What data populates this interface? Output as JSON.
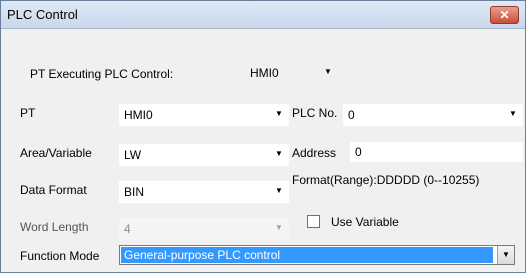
{
  "window": {
    "title": "PLC Control",
    "close_glyph": "✕"
  },
  "pt_executing": {
    "label": "PT Executing PLC Control:",
    "value": "HMI0"
  },
  "pt": {
    "label": "PT",
    "value": "HMI0"
  },
  "plc_no": {
    "label": "PLC No.",
    "value": "0"
  },
  "area_variable": {
    "label": "Area/Variable",
    "value": "LW"
  },
  "address": {
    "label": "Address",
    "value": "0"
  },
  "data_format": {
    "label": "Data Format",
    "value": "BIN"
  },
  "format_range": {
    "text": "Format(Range):DDDDD (0--10255)"
  },
  "word_length": {
    "label": "Word Length",
    "value": "4"
  },
  "use_variable": {
    "label": "Use Variable",
    "checked": false
  },
  "function_mode": {
    "label": "Function Mode",
    "value": "General-purpose PLC control"
  },
  "icons": {
    "dropdown": "chevron-down-icon",
    "close": "close-icon"
  }
}
